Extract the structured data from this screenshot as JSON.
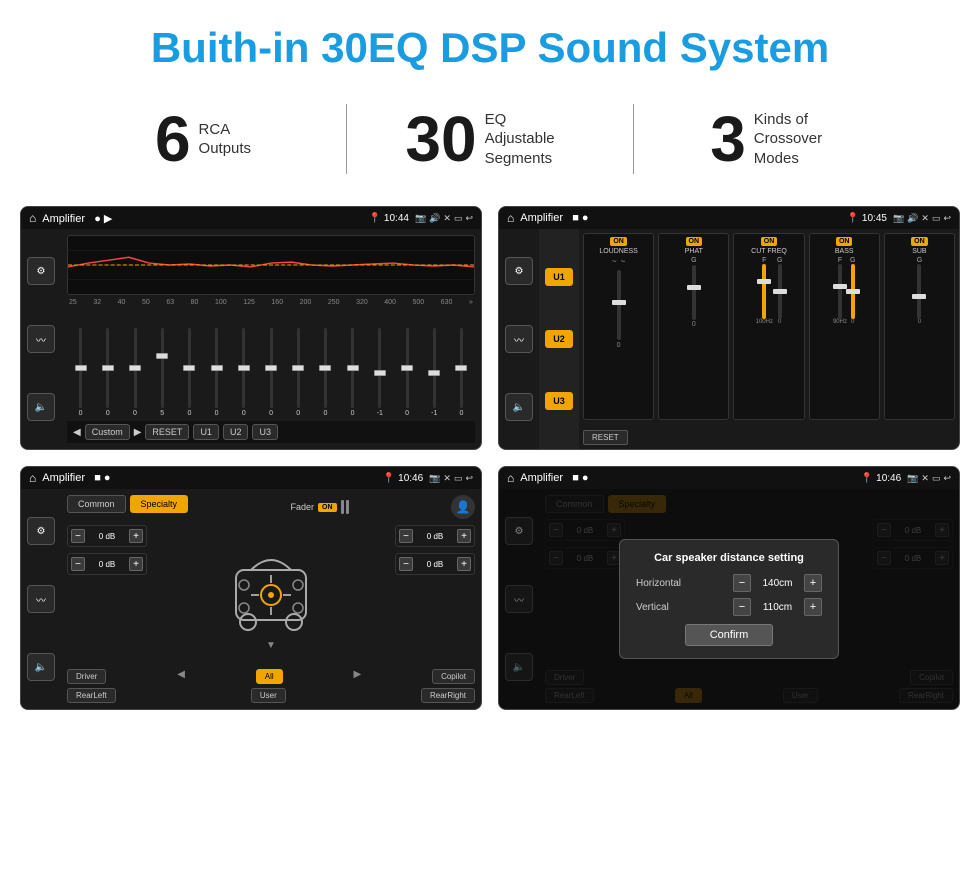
{
  "header": {
    "title": "Buith-in 30EQ DSP Sound System"
  },
  "stats": [
    {
      "number": "6",
      "label": "RCA\nOutputs"
    },
    {
      "number": "30",
      "label": "EQ Adjustable\nSegments"
    },
    {
      "number": "3",
      "label": "Kinds of\nCrossover Modes"
    }
  ],
  "screens": {
    "eq": {
      "title": "Amplifier",
      "time": "10:44",
      "frequencies": [
        "25",
        "32",
        "40",
        "50",
        "63",
        "80",
        "100",
        "125",
        "160",
        "200",
        "250",
        "320",
        "400",
        "500",
        "630"
      ],
      "values": [
        "0",
        "0",
        "0",
        "5",
        "0",
        "0",
        "0",
        "0",
        "0",
        "0",
        "0",
        "-1",
        "0",
        "-1"
      ],
      "bottomBtns": [
        "Custom",
        "RESET",
        "U1",
        "U2",
        "U3"
      ]
    },
    "amp": {
      "title": "Amplifier",
      "time": "10:45",
      "uBtns": [
        "U1",
        "U2",
        "U3"
      ],
      "controls": [
        "LOUDNESS",
        "PHAT",
        "CUT FREQ",
        "BASS",
        "SUB"
      ],
      "resetBtn": "RESET"
    },
    "fader": {
      "title": "Amplifier",
      "time": "10:46",
      "tabs": [
        "Common",
        "Specialty"
      ],
      "faderLabel": "Fader",
      "onLabel": "ON",
      "dbValues": [
        "0 dB",
        "0 dB",
        "0 dB",
        "0 dB"
      ],
      "bottomBtns": [
        "Driver",
        "Copilot",
        "RearLeft",
        "All",
        "User",
        "RearRight"
      ]
    },
    "dialog": {
      "title": "Amplifier",
      "time": "10:46",
      "tabs": [
        "Common",
        "Specialty"
      ],
      "dialogTitle": "Car speaker distance setting",
      "horizontal": {
        "label": "Horizontal",
        "value": "140cm"
      },
      "vertical": {
        "label": "Vertical",
        "value": "110cm"
      },
      "confirmBtn": "Confirm",
      "dbValues": [
        "0 dB",
        "0 dB"
      ],
      "bottomBtns": [
        "Driver",
        "Copilot",
        "RearLeft",
        "All",
        "User",
        "RearRight"
      ]
    }
  },
  "colors": {
    "accent": "#1a9de0",
    "yellow": "#f0a500",
    "dark": "#1a1a1a",
    "bg": "#ffffff"
  }
}
